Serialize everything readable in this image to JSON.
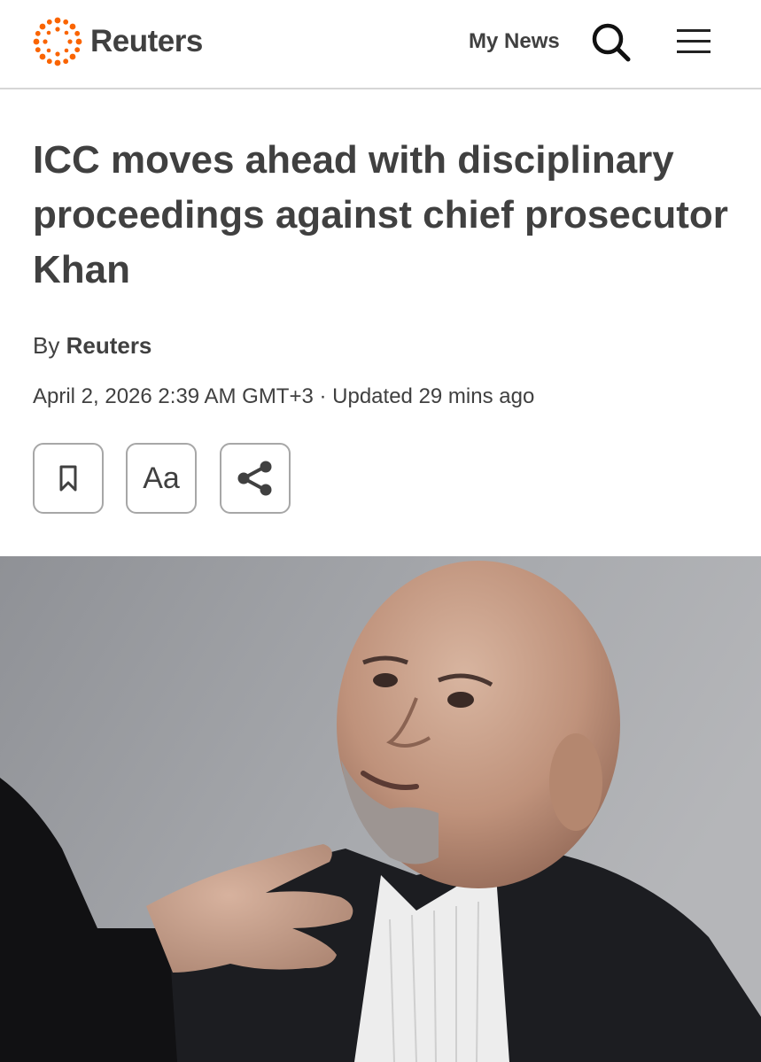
{
  "header": {
    "brand": "Reuters",
    "brand_color": "#fa6400",
    "my_news_label": "My News",
    "search_icon": "search-icon",
    "menu_icon": "hamburger-menu-icon"
  },
  "article": {
    "headline": "ICC moves ahead with disciplinary proceedings against chief prosecutor Khan",
    "byline_prefix": "By",
    "author": "Reuters",
    "dateline": "April 2, 2026 2:39 AM GMT+3 · Updated 29 mins ago",
    "tools": {
      "bookmark_icon": "bookmark-icon",
      "text_size_label": "Aa",
      "share_icon": "share-icon"
    }
  },
  "colors": {
    "text": "#404040",
    "divider": "#d6d6d6",
    "button_border": "#a7a7a7"
  }
}
